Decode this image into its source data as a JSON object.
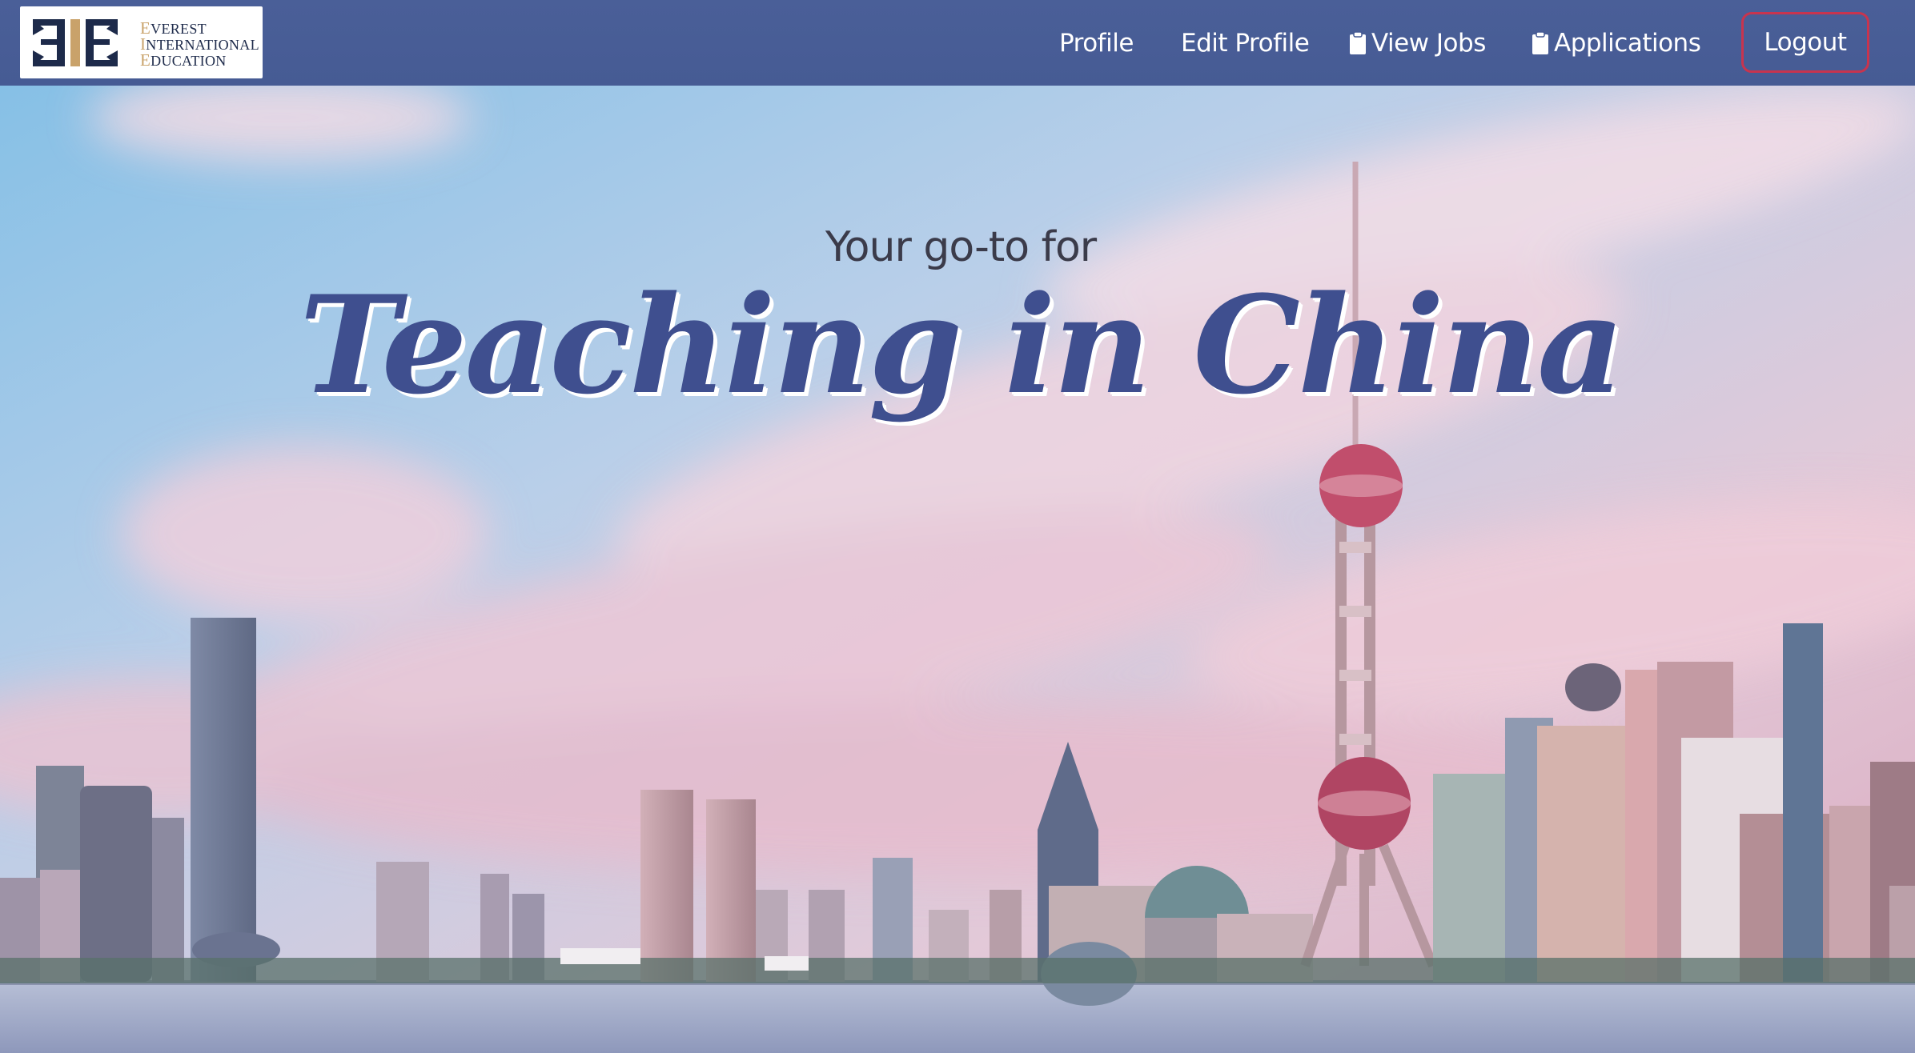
{
  "brand": {
    "logo_text": "EVEREST INTERNATIONAL EDUCATION",
    "lines": [
      {
        "cap": "E",
        "rest": "VEREST"
      },
      {
        "cap": "I",
        "rest": "NTERNATIONAL"
      },
      {
        "cap": "E",
        "rest": "DUCATION"
      }
    ]
  },
  "nav": {
    "profile": "Profile",
    "edit_profile": "Edit Profile",
    "view_jobs": "View Jobs",
    "applications": "Applications",
    "logout": "Logout"
  },
  "hero": {
    "tagline": "Your go-to for",
    "headline": "Teaching in China",
    "background": "shanghai-skyline-image"
  },
  "colors": {
    "navbar": "#4a5f98",
    "logout_border": "#c8344e",
    "headline": "#3f4f8f"
  }
}
